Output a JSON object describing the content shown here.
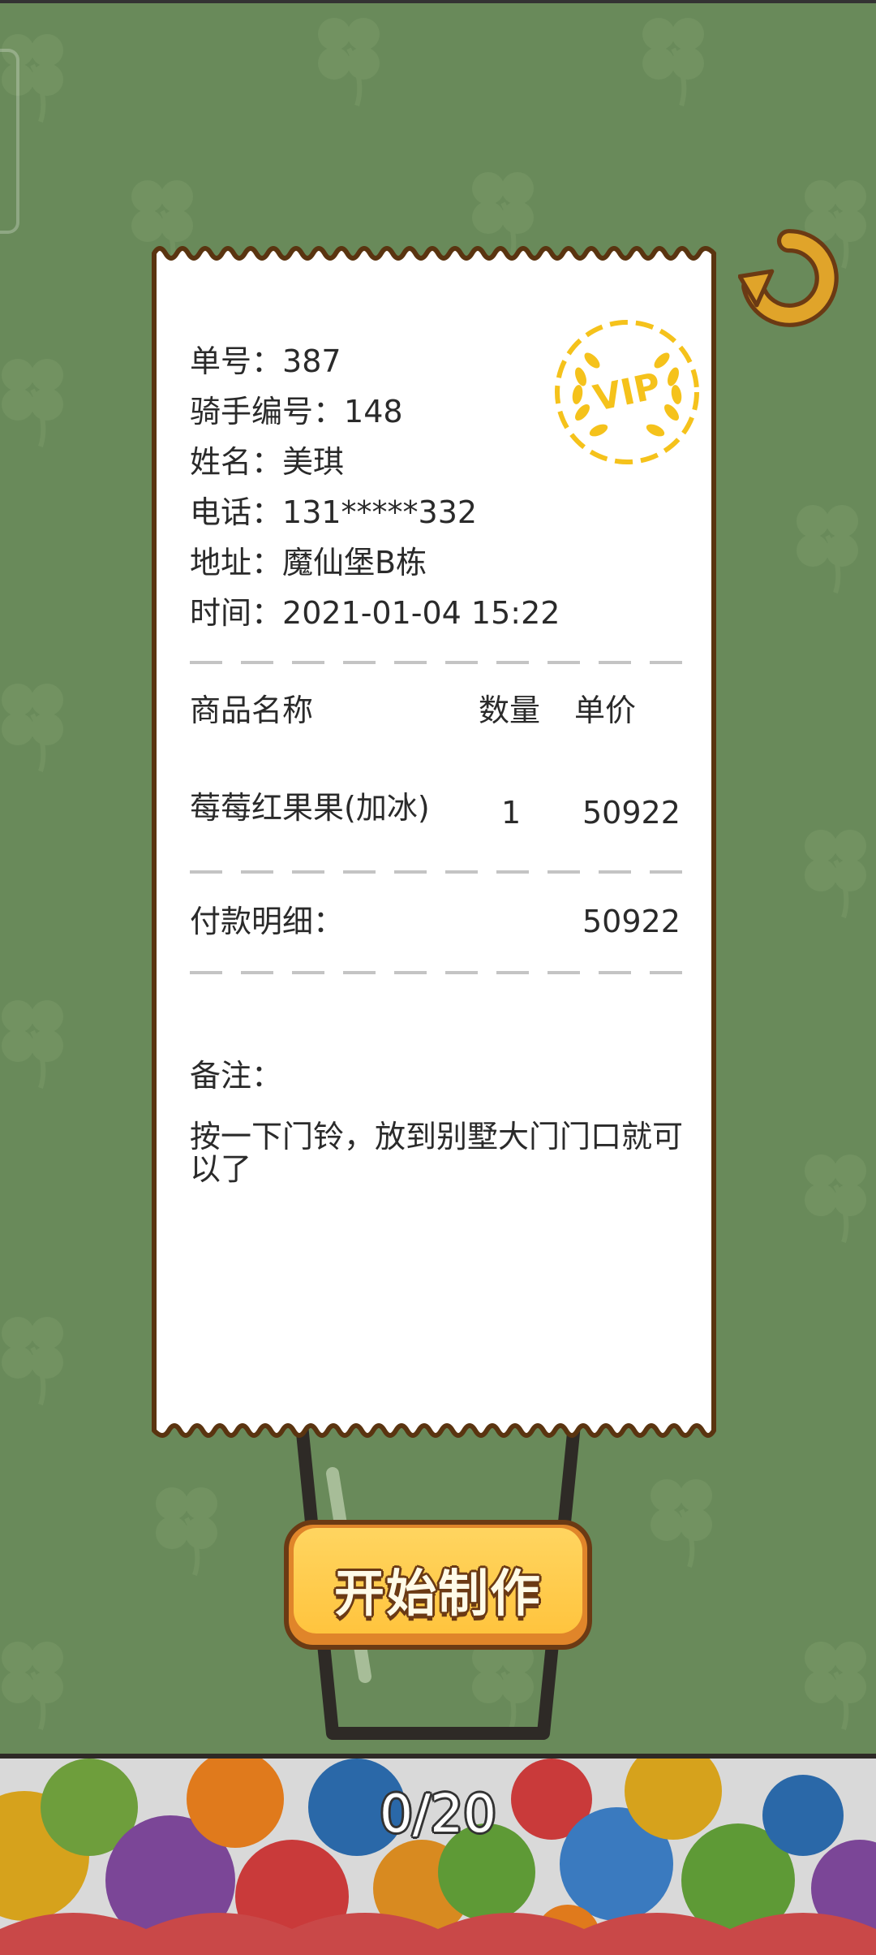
{
  "order": {
    "order_no_label": "单号：",
    "order_no": "387",
    "rider_label": "骑手编号：",
    "rider_no": "148",
    "name_label": "姓名：",
    "name": "美琪",
    "phone_label": "电话：",
    "phone": "131*****332",
    "address_label": "地址：",
    "address": "魔仙堡B栋",
    "time_label": "时间：",
    "time": "2021-01-04 15:22"
  },
  "vip_badge": {
    "text": "VIP",
    "color": "#f5c21b"
  },
  "items_table": {
    "headers": {
      "name": "商品名称",
      "qty": "数量",
      "price": "单价"
    },
    "rows": [
      {
        "name": "莓莓红果果(加冰)",
        "qty": "1",
        "price": "50922"
      }
    ]
  },
  "payment": {
    "label": "付款明细：",
    "amount": "50922"
  },
  "remark": {
    "label": "备注：",
    "text": "按一下门铃，放到别墅大门门口就可以了"
  },
  "start_button": {
    "label": "开始制作"
  },
  "progress": {
    "text": "0/20"
  },
  "colors": {
    "background": "#698a5a",
    "button": "#ffc43e",
    "outline": "#6b3a14",
    "refresh_icon": "#e0a42a"
  },
  "icons": {
    "refresh": "refresh-icon",
    "vip": "vip-badge-icon"
  }
}
